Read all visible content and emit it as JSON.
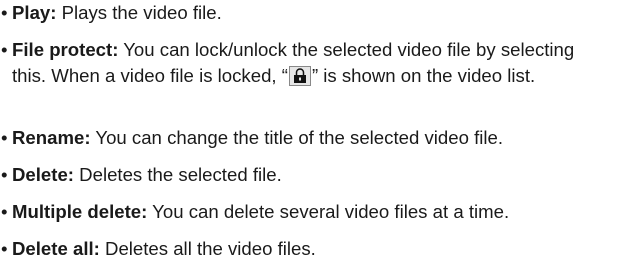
{
  "items": [
    {
      "term": "Play:",
      "text": " Plays the video file."
    },
    {
      "term": "File protect:",
      "text_before": " You can lock/unlock the selected video file by selecting this. When a video file is locked, “",
      "icon": "lock-icon",
      "text_after": "” is shown on the video list."
    },
    {
      "term": "Rename:",
      "text": " You can change the title of the selected video file."
    },
    {
      "term": "Delete:",
      "text": " Deletes the selected file."
    },
    {
      "term": "Multiple delete:",
      "text": " You can delete several video files at a time."
    },
    {
      "term": "Delete all:",
      "text": " Deletes all the video files."
    }
  ]
}
